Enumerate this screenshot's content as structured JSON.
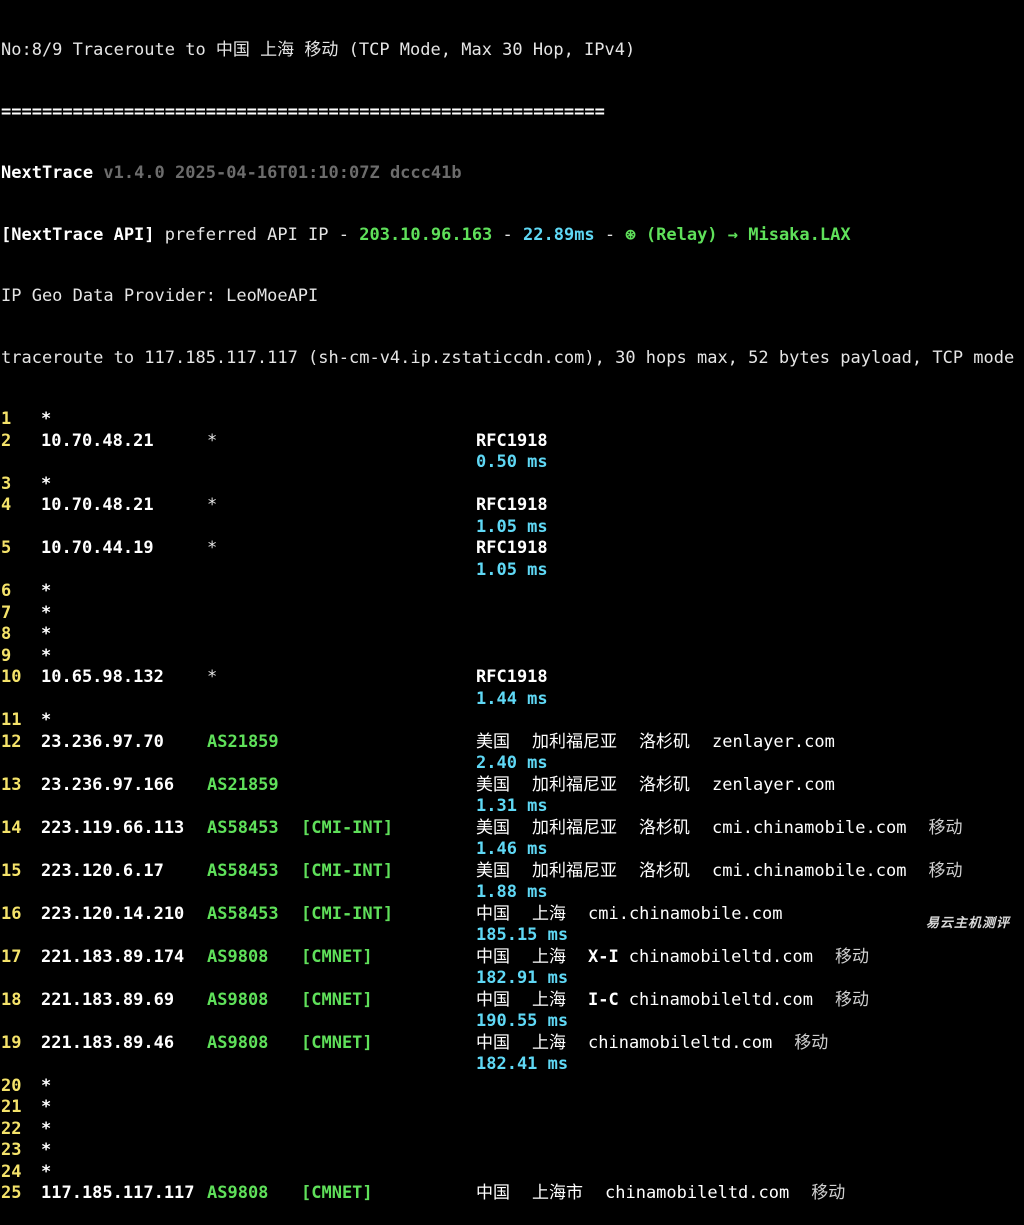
{
  "header": {
    "title": "No:8/9 Traceroute to 中国 上海 移动 (TCP Mode, Max 30 Hop, IPv4)",
    "separator": "==========================================================="
  },
  "nexttrace": {
    "name": "NextTrace",
    "version": "v1.4.0 2025-04-16T01:10:07Z dccc41b"
  },
  "api": {
    "label": "[NextTrace API]",
    "text1": " preferred API IP - ",
    "ip": "203.10.96.163",
    "dash1": " - ",
    "latency": "22.89ms",
    "dash2": " - ",
    "relay": "(Relay) → Misaka.LAX",
    "relay_icon": "⊛"
  },
  "geo_provider": "IP Geo Data Provider: LeoMoeAPI",
  "trace_line": "traceroute to 117.185.117.117 (sh-cm-v4.ip.zstaticcdn.com), 30 hops max, 52 bytes payload, TCP mode",
  "hops": [
    {
      "num": "1",
      "ip": "*"
    },
    {
      "num": "2",
      "ip": "10.70.48.21",
      "as": "*",
      "geo": "RFC1918",
      "rtt": "0.50 ms"
    },
    {
      "num": "3",
      "ip": "*"
    },
    {
      "num": "4",
      "ip": "10.70.48.21",
      "as": "*",
      "geo": "RFC1918",
      "rtt": "1.05 ms"
    },
    {
      "num": "5",
      "ip": "10.70.44.19",
      "as": "*",
      "geo": "RFC1918",
      "rtt": "1.05 ms"
    },
    {
      "num": "6",
      "ip": "*"
    },
    {
      "num": "7",
      "ip": "*"
    },
    {
      "num": "8",
      "ip": "*"
    },
    {
      "num": "9",
      "ip": "*"
    },
    {
      "num": "10",
      "ip": "10.65.98.132",
      "as": "*",
      "geo": "RFC1918",
      "rtt": "1.44 ms"
    },
    {
      "num": "11",
      "ip": "*"
    },
    {
      "num": "12",
      "ip": "23.236.97.70",
      "as": "AS21859",
      "country": "美国",
      "prov": "加利福尼亚",
      "city": "洛杉矶",
      "host": "zenlayer.com",
      "rtt": "2.40 ms"
    },
    {
      "num": "13",
      "ip": "23.236.97.166",
      "as": "AS21859",
      "country": "美国",
      "prov": "加利福尼亚",
      "city": "洛杉矶",
      "host": "zenlayer.com",
      "rtt": "1.31 ms"
    },
    {
      "num": "14",
      "ip": "223.119.66.113",
      "as": "AS58453",
      "tag": "[CMI-INT]",
      "country": "美国",
      "prov": "加利福尼亚",
      "city": "洛杉矶",
      "host": "cmi.chinamobile.com",
      "isp": "移动",
      "rtt": "1.46 ms"
    },
    {
      "num": "15",
      "ip": "223.120.6.17",
      "as": "AS58453",
      "tag": "[CMI-INT]",
      "country": "美国",
      "prov": "加利福尼亚",
      "city": "洛杉矶",
      "host": "cmi.chinamobile.com",
      "isp": "移动",
      "rtt": "1.88 ms"
    },
    {
      "num": "16",
      "ip": "223.120.14.210",
      "as": "AS58453",
      "tag": "[CMI-INT]",
      "country": "中国",
      "prov": "上海",
      "host": "cmi.chinamobile.com",
      "rtt": "185.15 ms"
    },
    {
      "num": "17",
      "ip": "221.183.89.174",
      "as": "AS9808",
      "tag": "[CMNET]",
      "country": "中国",
      "prov": "上海",
      "city": "X-I",
      "host": "chinamobileltd.com",
      "isp": "移动",
      "rtt": "182.91 ms"
    },
    {
      "num": "18",
      "ip": "221.183.89.69",
      "as": "AS9808",
      "tag": "[CMNET]",
      "country": "中国",
      "prov": "上海",
      "city": "I-C",
      "host": "chinamobileltd.com",
      "isp": "移动",
      "rtt": "190.55 ms"
    },
    {
      "num": "19",
      "ip": "221.183.89.46",
      "as": "AS9808",
      "tag": "[CMNET]",
      "country": "中国",
      "prov": "上海",
      "host": "chinamobileltd.com",
      "isp": "移动",
      "rtt": "182.41 ms"
    },
    {
      "num": "20",
      "ip": "*"
    },
    {
      "num": "21",
      "ip": "*"
    },
    {
      "num": "22",
      "ip": "*"
    },
    {
      "num": "23",
      "ip": "*"
    },
    {
      "num": "24",
      "ip": "*"
    },
    {
      "num": "25",
      "ip": "117.185.117.117",
      "as": "AS9808",
      "tag": "[CMNET]",
      "country": "中国",
      "prov": "上海市",
      "host": "chinamobileltd.com",
      "isp": "移动"
    }
  ],
  "watermark": "易云主机测评",
  "colors": {
    "background": "#000000",
    "hop_number": "#f5e36a",
    "asn": "#5fe05a",
    "latency": "#5fd8f5",
    "text": "#e5e5e5"
  }
}
